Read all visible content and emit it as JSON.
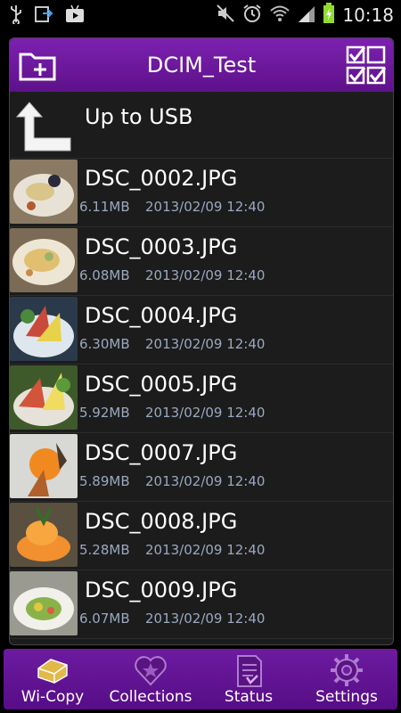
{
  "status_bar": {
    "time": "10:18",
    "left_icons": [
      "usb-icon",
      "download-icon",
      "play-store-icon"
    ],
    "right_icons": [
      "mute-icon",
      "alarm-icon",
      "wifi-icon",
      "signal-icon",
      "battery-charging-icon"
    ]
  },
  "header": {
    "title": "DCIM_Test",
    "left_icon": "new-folder-icon",
    "right_icon": "select-all-icon"
  },
  "up_row": {
    "label": "Up to USB",
    "icon": "up-arrow-icon"
  },
  "files": [
    {
      "name": "DSC_0002.JPG",
      "size": "6.11MB",
      "date": "2013/02/09 12:40"
    },
    {
      "name": "DSC_0003.JPG",
      "size": "6.08MB",
      "date": "2013/02/09 12:40"
    },
    {
      "name": "DSC_0004.JPG",
      "size": "6.30MB",
      "date": "2013/02/09 12:40"
    },
    {
      "name": "DSC_0005.JPG",
      "size": "5.92MB",
      "date": "2013/02/09 12:40"
    },
    {
      "name": "DSC_0007.JPG",
      "size": "5.89MB",
      "date": "2013/02/09 12:40"
    },
    {
      "name": "DSC_0008.JPG",
      "size": "5.28MB",
      "date": "2013/02/09 12:40"
    },
    {
      "name": "DSC_0009.JPG",
      "size": "6.07MB",
      "date": "2013/02/09 12:40"
    }
  ],
  "tabs": [
    {
      "label": "Wi-Copy",
      "icon": "wi-copy-drive-icon"
    },
    {
      "label": "Collections",
      "icon": "star-heart-icon"
    },
    {
      "label": "Status",
      "icon": "status-document-icon"
    },
    {
      "label": "Settings",
      "icon": "gear-icon"
    }
  ],
  "colors": {
    "accent": "#6d1ba0",
    "list_bg": "#1c1c1c",
    "meta_text": "#9aa8c0"
  }
}
